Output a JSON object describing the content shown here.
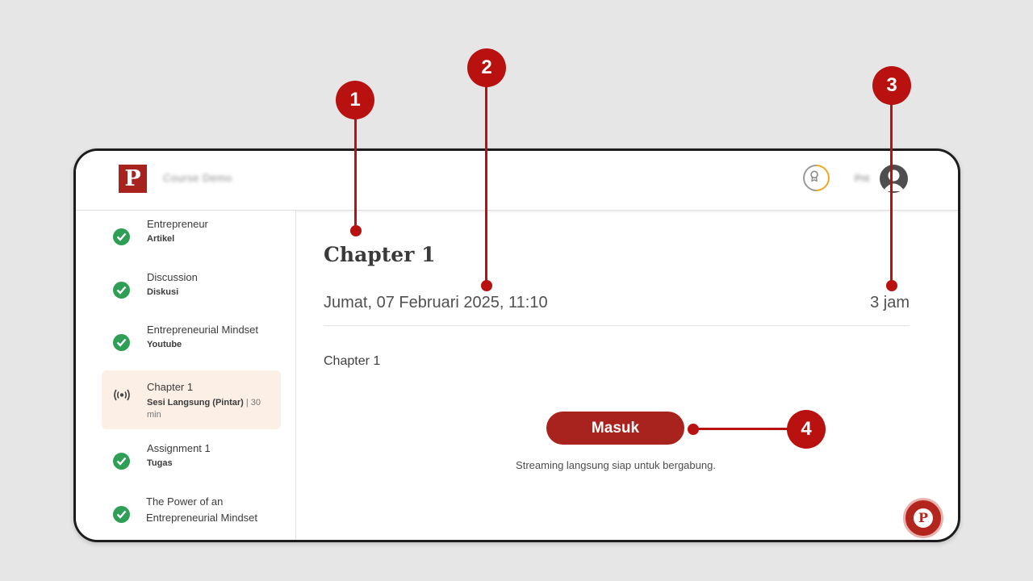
{
  "header": {
    "logo_letter": "P",
    "course_title": "Course Demo",
    "user_name": "Pnt"
  },
  "sidebar": {
    "items": [
      {
        "title": "Entrepreneur",
        "type": "Artikel",
        "status": "completed",
        "icon": "check-circle-icon"
      },
      {
        "title": "Discussion",
        "type": "Diskusi",
        "status": "completed",
        "icon": "check-circle-icon"
      },
      {
        "title": "Entrepreneurial Mindset",
        "type": "Youtube",
        "status": "completed",
        "icon": "check-circle-icon"
      },
      {
        "title": "Chapter 1",
        "type": "Sesi Langsung (Pintar)",
        "extra": "| 30",
        "extra2": "min",
        "status": "active",
        "icon": "live-broadcast-icon"
      },
      {
        "title": "Assignment 1",
        "type": "Tugas",
        "status": "completed",
        "icon": "check-circle-icon"
      },
      {
        "title": "The Power of an",
        "title_line2": "Entrepreneurial Mindset",
        "status": "completed",
        "icon": "check-circle-icon"
      }
    ]
  },
  "main": {
    "title": "Chapter 1",
    "datetime": "Jumat, 07 Februari 2025, 11:10",
    "duration": "3 jam",
    "description": "Chapter 1",
    "join_label": "Masuk",
    "stream_note": "Streaming langsung siap untuk bergabung."
  },
  "chat_fab": {
    "letter": "P"
  },
  "callouts": [
    "1",
    "2",
    "3",
    "4"
  ],
  "colors": {
    "brand": "#a8231d",
    "callout": "#b8110f",
    "check": "#2f9e56",
    "active_bg": "#fbefe6"
  }
}
